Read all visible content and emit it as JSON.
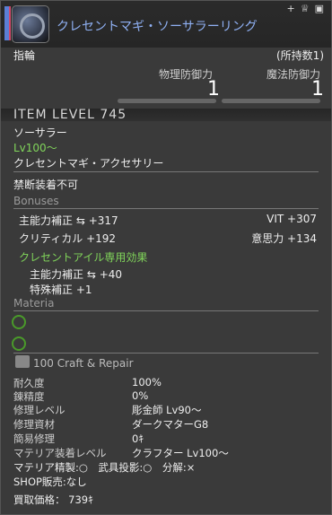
{
  "header": {
    "item_name": "クレセントマギ・ソーサラーリング",
    "top_icons": [
      "+",
      "♕",
      "▣"
    ]
  },
  "slot": "指輪",
  "owned": "(所持数1)",
  "defense": {
    "phys_label": "物理防御力",
    "mag_label": "魔法防御力",
    "phys_value": "1",
    "mag_value": "1"
  },
  "item_level": "ITEM LEVEL 745",
  "job": "ソーサラー",
  "level": "Lv100〜",
  "category": "クレセントマギ・アクセサリー",
  "restriction": "禁断装着不可",
  "bonuses": {
    "title": "Bonuses",
    "main_label": "主能力補正",
    "main_value": "+317",
    "vit": "VIT +307",
    "crit": "クリティカル +192",
    "will": "意思力 +134"
  },
  "crescent": {
    "title": "クレセントアイル専用効果",
    "main_label": "主能力補正",
    "main_value": "+40",
    "special": "特殊補正 +1"
  },
  "materia": {
    "title": "Materia"
  },
  "craft": {
    "title": "100 Craft & Repair"
  },
  "info": [
    {
      "k": "耐久度",
      "v": "100%"
    },
    {
      "k": "錬精度",
      "v": "0%"
    },
    {
      "k": "修理レベル",
      "v": "彫金師 Lv90〜"
    },
    {
      "k": "修理資材",
      "v": "ダークマターG8"
    },
    {
      "k": "簡易修理",
      "v": "0ｷ"
    },
    {
      "k": "マテリア装着レベル",
      "v": "クラフター Lv100〜"
    }
  ],
  "materia_line": "マテリア精製:○　武具投影:○　分解:×",
  "shop": "SHOP販売:なし",
  "price": "買取価格： 739ｷ"
}
